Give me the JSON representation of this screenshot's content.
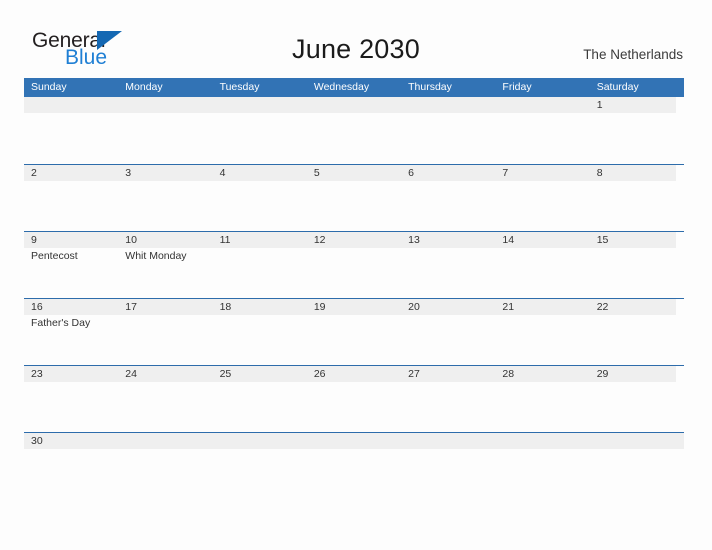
{
  "branding": {
    "name_part1": "General",
    "name_part2": "Blue",
    "logo_icon": "blue-flag-triangle"
  },
  "header": {
    "title": "June 2030",
    "region": "The Netherlands"
  },
  "colors": {
    "header_blue": "#3273b5",
    "row_divider_blue": "#2d6cab",
    "date_band_gray": "#efefef",
    "logo_blue": "#1f7fd4",
    "text": "#333333"
  },
  "calendar": {
    "weekdays": [
      "Sunday",
      "Monday",
      "Tuesday",
      "Wednesday",
      "Thursday",
      "Friday",
      "Saturday"
    ],
    "weeks": [
      [
        {
          "day": "",
          "event": ""
        },
        {
          "day": "",
          "event": ""
        },
        {
          "day": "",
          "event": ""
        },
        {
          "day": "",
          "event": ""
        },
        {
          "day": "",
          "event": ""
        },
        {
          "day": "",
          "event": ""
        },
        {
          "day": "1",
          "event": ""
        }
      ],
      [
        {
          "day": "2",
          "event": ""
        },
        {
          "day": "3",
          "event": ""
        },
        {
          "day": "4",
          "event": ""
        },
        {
          "day": "5",
          "event": ""
        },
        {
          "day": "6",
          "event": ""
        },
        {
          "day": "7",
          "event": ""
        },
        {
          "day": "8",
          "event": ""
        }
      ],
      [
        {
          "day": "9",
          "event": "Pentecost"
        },
        {
          "day": "10",
          "event": "Whit Monday"
        },
        {
          "day": "11",
          "event": ""
        },
        {
          "day": "12",
          "event": ""
        },
        {
          "day": "13",
          "event": ""
        },
        {
          "day": "14",
          "event": ""
        },
        {
          "day": "15",
          "event": ""
        }
      ],
      [
        {
          "day": "16",
          "event": "Father's Day"
        },
        {
          "day": "17",
          "event": ""
        },
        {
          "day": "18",
          "event": ""
        },
        {
          "day": "19",
          "event": ""
        },
        {
          "day": "20",
          "event": ""
        },
        {
          "day": "21",
          "event": ""
        },
        {
          "day": "22",
          "event": ""
        }
      ],
      [
        {
          "day": "23",
          "event": ""
        },
        {
          "day": "24",
          "event": ""
        },
        {
          "day": "25",
          "event": ""
        },
        {
          "day": "26",
          "event": ""
        },
        {
          "day": "27",
          "event": ""
        },
        {
          "day": "28",
          "event": ""
        },
        {
          "day": "29",
          "event": ""
        }
      ],
      [
        {
          "day": "30",
          "event": ""
        },
        {
          "day": "",
          "event": ""
        },
        {
          "day": "",
          "event": ""
        },
        {
          "day": "",
          "event": ""
        },
        {
          "day": "",
          "event": ""
        },
        {
          "day": "",
          "event": ""
        },
        {
          "day": "",
          "event": ""
        }
      ]
    ]
  }
}
